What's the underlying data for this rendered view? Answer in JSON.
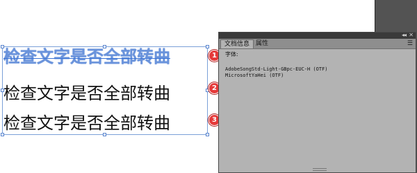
{
  "canvas": {
    "lines": [
      {
        "text": "检查文字是否全部转曲",
        "badge": "1"
      },
      {
        "text": "检查文字是否全部转曲",
        "badge": "2"
      },
      {
        "first": "检",
        "rest": "查文字是否全部转曲",
        "badge": "3"
      }
    ]
  },
  "panel": {
    "tabs": [
      {
        "label": "文档信息",
        "active": true
      },
      {
        "label": "属性",
        "active": false
      }
    ],
    "collapse_glyph": "◂◂",
    "close_glyph": "✕",
    "menu_glyph": "☰",
    "section_label": "字体:",
    "fonts": [
      "AdobeSongStd-Light-GBpc-EUC-H (OTF)",
      "MicrosoftYaHei (OTF)"
    ]
  },
  "colors": {
    "badge": "#e53a3a",
    "outline_blue": "#3b74d6",
    "panel_bg": "#b3b3b3"
  }
}
